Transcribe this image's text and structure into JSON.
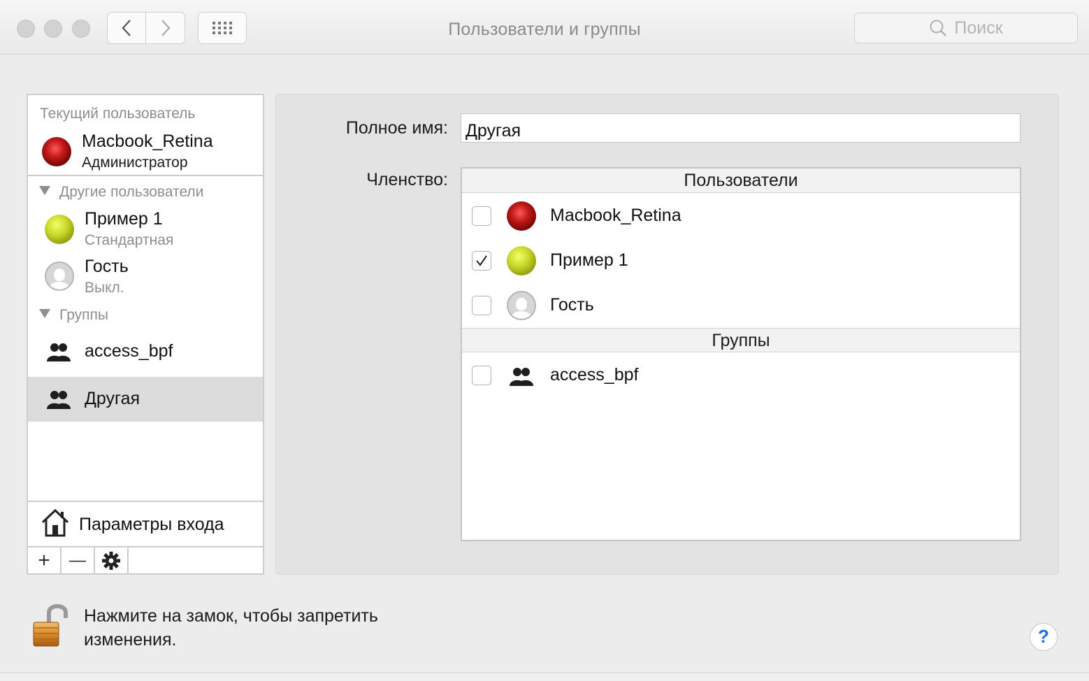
{
  "window": {
    "title": "Пользователи и группы",
    "search_placeholder": "Поиск"
  },
  "sidebar": {
    "current_user_header": "Текущий пользователь",
    "current_user": {
      "name": "Macbook_Retina",
      "role": "Администратор",
      "avatar": "rose"
    },
    "other_users_header": "Другие пользователи",
    "other_users": [
      {
        "name": "Пример 1",
        "role": "Стандартная",
        "avatar": "tennis-ball"
      },
      {
        "name": "Гость",
        "role": "Выкл.",
        "avatar": "guest"
      }
    ],
    "groups_header": "Группы",
    "groups": [
      {
        "name": "access_bpf"
      },
      {
        "name": "Другая"
      }
    ],
    "selected": "Другая",
    "login_options": "Параметры входа",
    "add_symbol": "+",
    "remove_symbol": "—"
  },
  "detail": {
    "full_name_label": "Полное имя:",
    "full_name_value": "Другая",
    "membership_label": "Членство:",
    "users_header": "Пользователи",
    "users": [
      {
        "name": "Macbook_Retina",
        "checked": false,
        "avatar": "rose"
      },
      {
        "name": "Пример 1",
        "checked": true,
        "avatar": "tennis-ball"
      },
      {
        "name": "Гость",
        "checked": false,
        "avatar": "guest"
      }
    ],
    "groups_header": "Группы",
    "groups": [
      {
        "name": "access_bpf",
        "checked": false
      }
    ]
  },
  "footer": {
    "lock_message": "Нажмите на замок, чтобы запретить изменения.",
    "help_symbol": "?"
  }
}
